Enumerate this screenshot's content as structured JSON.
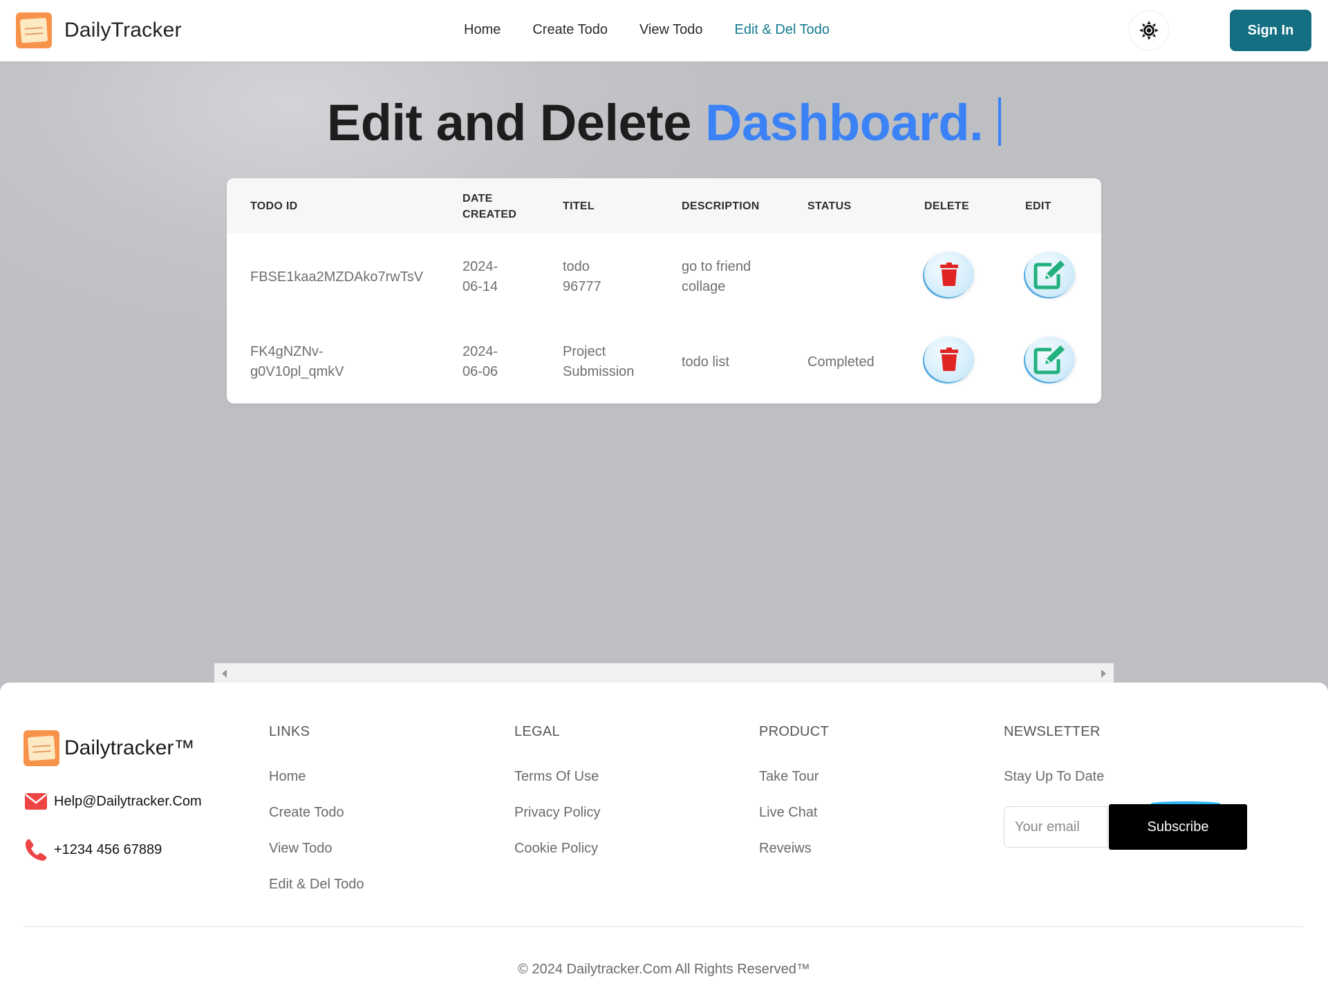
{
  "nav": {
    "brand": "DailyTracker",
    "links": [
      "Home",
      "Create Todo",
      "View Todo",
      "Edit & Del Todo"
    ],
    "active_link": "Edit & Del Todo",
    "signin_label": "Sign In",
    "theme_icon": "sun-icon"
  },
  "heading": {
    "main": "Edit and Delete ",
    "accent": "Dashboard."
  },
  "table": {
    "headers": {
      "todo_id": "TODO ID",
      "date_line1": "DATE",
      "date_line2": "CREATED",
      "title": "TITEL",
      "description": "DESCRIPTION",
      "status": "STATUS",
      "delete": "DELETE",
      "edit": "EDIT"
    },
    "rows": [
      {
        "id_line1": "FBSE1kaa2MZDAko7rwTsV",
        "id_line2": "",
        "date_line1": "2024-",
        "date_line2": "06-14",
        "title_line1": "todo",
        "title_line2": "96777",
        "desc_line1": "go to friend",
        "desc_line2": "collage",
        "status": ""
      },
      {
        "id_line1": "FK4gNZNv-",
        "id_line2": "g0V10pl_qmkV",
        "date_line1": "2024-",
        "date_line2": "06-06",
        "title_line1": "Project",
        "title_line2": "Submission",
        "desc_line1": "todo list",
        "desc_line2": "",
        "status": "Completed"
      }
    ]
  },
  "footer": {
    "brand": "Dailytracker™",
    "email": "Help@Dailytracker.Com",
    "phone": "+1234 456 67889",
    "columns": {
      "links": {
        "title": "LINKS",
        "items": [
          "Home",
          "Create Todo",
          "View Todo",
          "Edit & Del Todo"
        ]
      },
      "legal": {
        "title": "LEGAL",
        "items": [
          "Terms Of Use",
          "Privacy Policy",
          "Cookie Policy"
        ]
      },
      "product": {
        "title": "PRODUCT",
        "items": [
          "Take Tour",
          "Live Chat",
          "Reveiws"
        ]
      },
      "newsletter": {
        "title": "NEWSLETTER",
        "subtitle": "Stay Up To Date",
        "email_placeholder": "Your email",
        "subscribe_label": "Subscribe"
      }
    },
    "copyright": "© 2024 Dailytracker.Com All Rights Reserved™"
  },
  "colors": {
    "accent_blue": "#3b82f6",
    "brand_teal": "#146f82",
    "delete_red": "#e02424",
    "edit_green": "#22b07d"
  }
}
